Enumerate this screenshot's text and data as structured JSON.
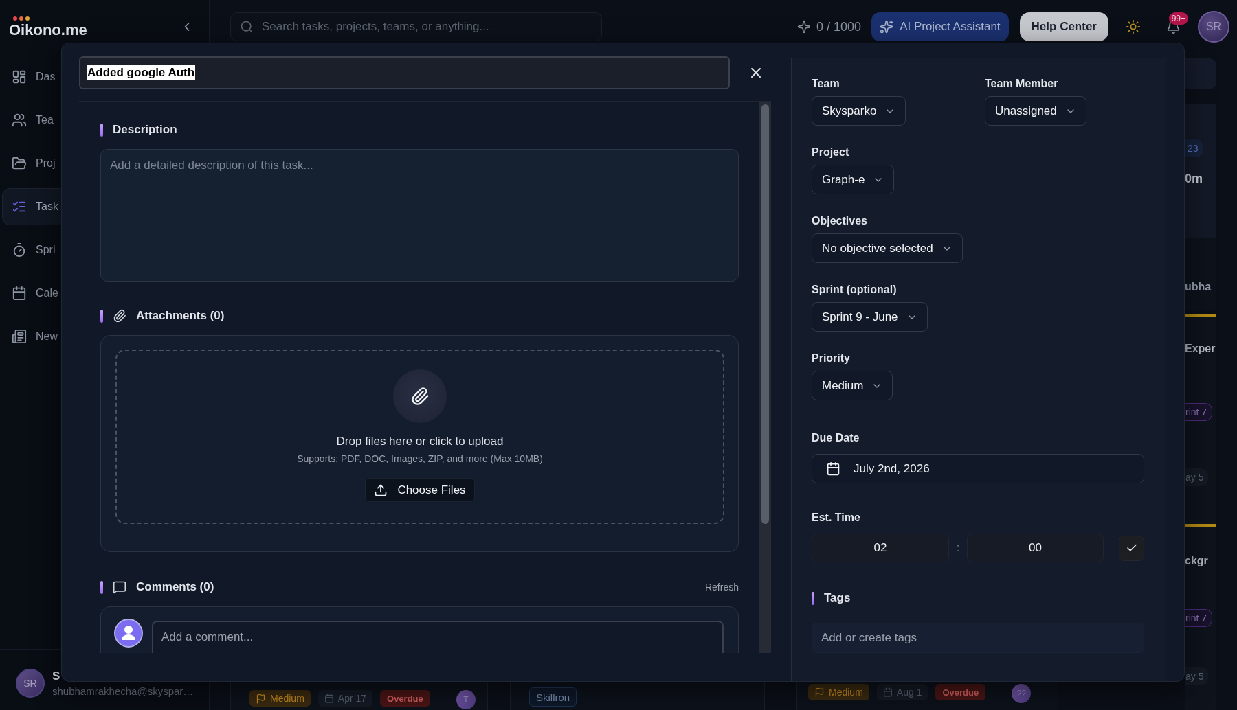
{
  "brand": {
    "logo": "Oikono.me"
  },
  "sidebar": {
    "items": [
      {
        "label": "Das",
        "selected": false
      },
      {
        "label": "Tea",
        "selected": false
      },
      {
        "label": "Proj",
        "selected": false
      },
      {
        "label": "Task",
        "selected": true
      },
      {
        "label": "Spri",
        "selected": false
      },
      {
        "label": "Cale",
        "selected": false
      },
      {
        "label": "New",
        "selected": false
      }
    ],
    "user": {
      "avatar": "SR",
      "name": "S",
      "email": "shubhamrakhecha@skyspar…"
    }
  },
  "header": {
    "search": {
      "placeholder": "Search tasks, projects, teams, or anything..."
    },
    "credits": "0 / 1000",
    "ai_button": "AI Project Assistant",
    "help_button": "Help Center",
    "notifications": {
      "badge": "99+"
    },
    "avatar": "SR"
  },
  "board": {
    "right_column": [
      {
        "accent": false,
        "items": [
          {
            "kind": "badge",
            "text": "23"
          },
          {
            "kind": "duration",
            "text": "0m"
          }
        ]
      },
      {
        "accent": false,
        "items": [
          {
            "kind": "name",
            "text": "ubha"
          }
        ]
      },
      {
        "accent": true,
        "items": [
          {
            "kind": "title",
            "text": "Exper"
          },
          {
            "kind": "sprint",
            "text": "rint 7"
          },
          {
            "kind": "date",
            "text": "ay 5"
          }
        ]
      },
      {
        "accent": true,
        "items": [
          {
            "kind": "title",
            "text": "ckgr"
          },
          {
            "kind": "sprint",
            "text": "rint 7"
          },
          {
            "kind": "date",
            "text": "ay 5"
          }
        ]
      }
    ],
    "bottom_cards": [
      {
        "tags": [
          {
            "kind": "priority",
            "text": "Medium"
          },
          {
            "kind": "date",
            "text": "Apr 17"
          },
          {
            "kind": "status",
            "text": "Overdue"
          },
          {
            "kind": "avatar",
            "text": "T"
          }
        ]
      },
      {
        "tags": [
          {
            "kind": "project",
            "text": "Skillron"
          }
        ]
      },
      {
        "tags": [
          {
            "kind": "priority",
            "text": "Medium"
          },
          {
            "kind": "date",
            "text": "Aug 1"
          },
          {
            "kind": "status",
            "text": "Overdue"
          },
          {
            "kind": "avatar",
            "text": "??"
          }
        ]
      }
    ]
  },
  "task_modal": {
    "title_field": {
      "value": "Added google Auth",
      "text_selected": true
    },
    "description": {
      "heading": "Description",
      "placeholder": "Add a detailed description of this task..."
    },
    "attachments": {
      "heading": "Attachments (0)",
      "drop_title": "Drop files here or click to upload",
      "drop_hint": "Supports: PDF, DOC, Images, ZIP, and more (Max 10MB)",
      "button": "Choose Files"
    },
    "comments": {
      "heading": "Comments (0)",
      "refresh": "Refresh",
      "placeholder": "Add a comment..."
    },
    "details": {
      "rows": [
        [
          {
            "kind": "select",
            "label": "Team",
            "value": "Skysparko"
          },
          {
            "kind": "select",
            "label": "Team Member",
            "value": "Unassigned"
          }
        ],
        [
          {
            "kind": "select",
            "label": "Project",
            "value": "Graph-e"
          }
        ],
        [
          {
            "kind": "select",
            "label": "Objectives",
            "value": "No objective selected"
          }
        ],
        [
          {
            "kind": "select",
            "label": "Sprint (optional)",
            "value": "Sprint 9 - June"
          }
        ],
        [
          {
            "kind": "select",
            "label": "Priority",
            "value": "Medium"
          }
        ],
        [
          {
            "kind": "date",
            "label": "Due Date",
            "value": "July 2nd, 2026"
          }
        ],
        [
          {
            "kind": "time",
            "label": "Est. Time",
            "hours": "02",
            "separator": ":",
            "minutes": "00"
          }
        ]
      ]
    },
    "tags": {
      "heading": "Tags",
      "placeholder": "Add or create tags"
    }
  }
}
